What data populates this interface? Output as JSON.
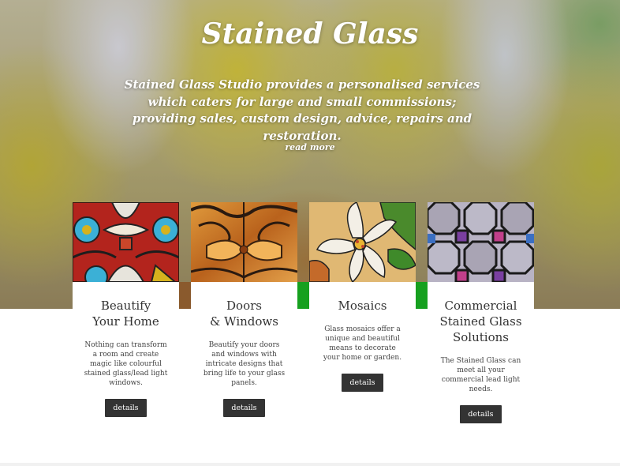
{
  "hero": {
    "title": "Stained Glass",
    "description": "Stained Glass Studio provides a personalised services which caters for large and small commissions; providing sales, custom design, advice, repairs and restoration.",
    "read_more": "read more"
  },
  "cards": [
    {
      "title_line1": "Beautify",
      "title_line2": "Your Home",
      "title_line3": "",
      "text": "Nothing can transform a room and create magic like colourful stained glass/lead light windows.",
      "button": "details",
      "image": "floral-red-stained-glass"
    },
    {
      "title_line1": "Doors",
      "title_line2": "& Windows",
      "title_line3": "",
      "text": "Beautify your doors and windows with intricate designs that bring life to your glass panels.",
      "button": "details",
      "image": "amber-door-stained-glass"
    },
    {
      "title_line1": "Mosaics",
      "title_line2": "",
      "title_line3": "",
      "text": "Glass mosaics offer a unique and beautiful means to decorate your home or garden.",
      "button": "details",
      "image": "lily-mosaic-glass"
    },
    {
      "title_line1": "Commercial",
      "title_line2": "Stained Glass",
      "title_line3": "Solutions",
      "text": "The Stained Glass can meet all your commercial lead light needs.",
      "button": "details",
      "image": "geometric-leadlight-glass"
    }
  ]
}
